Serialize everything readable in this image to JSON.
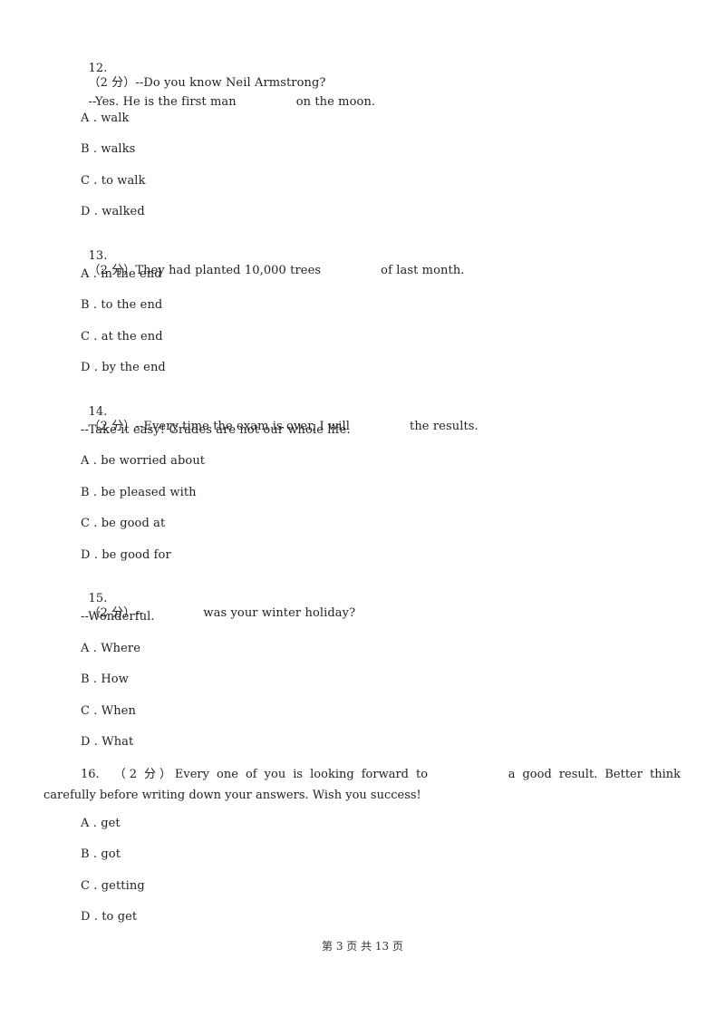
{
  "page": {
    "footer": "第 3 页 共 13 页"
  },
  "questions": [
    {
      "number": "12.",
      "score": "（2 分）",
      "stem_before": "--Do you know Neil Armstrong?",
      "stem_line2_before": "--Yes. He is the first man",
      "stem_line2_after": "on the moon.",
      "options": [
        {
          "letter": "A",
          "text": "walk"
        },
        {
          "letter": "B",
          "text": "walks"
        },
        {
          "letter": "C",
          "text": "to walk"
        },
        {
          "letter": "D",
          "text": "walked"
        }
      ]
    },
    {
      "number": "13.",
      "score": "（2 分）",
      "stem_before": "They had planted 10,000 trees",
      "stem_after": "of last month.",
      "options": [
        {
          "letter": "A",
          "text": "in the end"
        },
        {
          "letter": "B",
          "text": "to the end"
        },
        {
          "letter": "C",
          "text": "at the end"
        },
        {
          "letter": "D",
          "text": "by the end"
        }
      ]
    },
    {
      "number": "14.",
      "score": "（2 分）",
      "stem_before": "--Every time the exam is over, I will",
      "stem_after": "the results.",
      "stem_line2": "--Take it easy! Grades are not our whole life.",
      "options": [
        {
          "letter": "A",
          "text": "be worried about"
        },
        {
          "letter": "B",
          "text": "be pleased with"
        },
        {
          "letter": "C",
          "text": "be good at"
        },
        {
          "letter": "D",
          "text": "be good for"
        }
      ]
    },
    {
      "number": "15.",
      "score": "（2 分）",
      "stem_before": "--",
      "stem_after": "was your winter holiday?",
      "stem_line2": "--Wonderful.",
      "options": [
        {
          "letter": "A",
          "text": "Where"
        },
        {
          "letter": "B",
          "text": "How"
        },
        {
          "letter": "C",
          "text": "When"
        },
        {
          "letter": "D",
          "text": "What"
        }
      ]
    },
    {
      "number": "16.",
      "score": "（2 分）",
      "stem_before": "Every one of you is looking forward to",
      "stem_after": "a good result. Better think",
      "stem_line2": "carefully before writing down your answers. Wish you success!",
      "options": [
        {
          "letter": "A",
          "text": "get"
        },
        {
          "letter": "B",
          "text": "got"
        },
        {
          "letter": "C",
          "text": "getting"
        },
        {
          "letter": "D",
          "text": "to get"
        }
      ]
    }
  ],
  "option_separator": " . "
}
